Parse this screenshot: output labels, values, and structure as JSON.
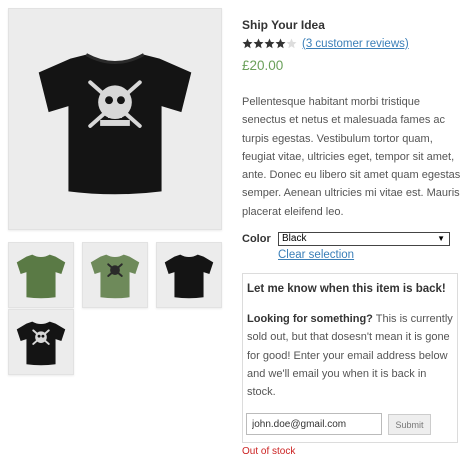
{
  "product": {
    "title": "Ship Your Idea",
    "rating": 4,
    "rating_max": 5,
    "reviews_link": "(3 customer reviews)",
    "price": "£20.00",
    "description": "Pellentesque habitant morbi tristique senectus et netus et malesuada fames ac turpis egestas. Vestibulum tortor quam, feugiat vitae, ultricies eget, tempor sit amet, ante. Donec eu libero sit amet quam egestas semper. Aenean ultricies mi vitae est. Mauris placerat eleifend leo."
  },
  "gallery": {
    "main": "black-skull-tshirt",
    "thumbnails": [
      "green-tshirt",
      "green-skull-tshirt",
      "black-tshirt",
      "black-skull-tshirt"
    ],
    "colors": {
      "black": "#141414",
      "green": "#5a7a45",
      "page_bg": "#ececec"
    }
  },
  "variations": {
    "color_label": "Color",
    "color_selected": "Black",
    "clear_link": "Clear selection"
  },
  "notify": {
    "title": "Let me know when this item is back!",
    "lead": "Looking for something?",
    "body": " This is currently sold out, but that dosesn't mean it is gone for good! Enter your email address below and we'll email you when it is back in stock.",
    "email_value": "john.doe@gmail.com",
    "submit_label": "Submit"
  },
  "stock_status": "Out of stock",
  "colors": {
    "link": "#3b7fb8",
    "price": "#6aa05a",
    "out_of_stock": "#cc2222"
  }
}
